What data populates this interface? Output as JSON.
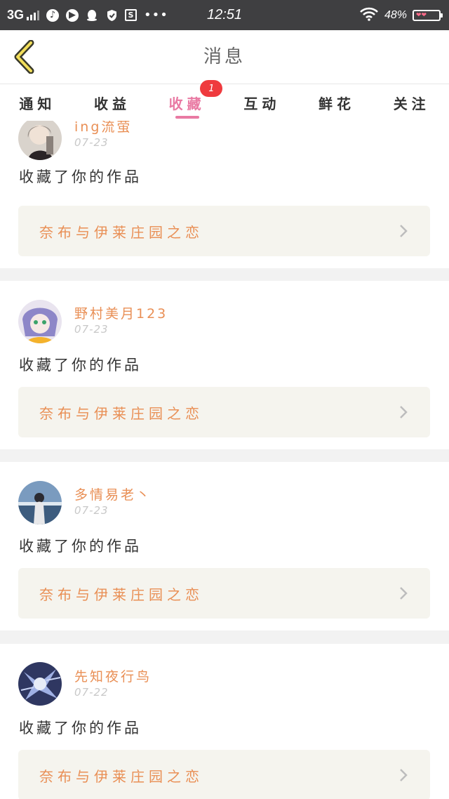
{
  "status_bar": {
    "network": "3G",
    "time": "12:51",
    "battery_percent": "48%",
    "battery_level": 0.48,
    "icons": [
      "signal-icon",
      "music-app-icon",
      "video-app-icon",
      "qq-icon",
      "shield-icon",
      "s-app-icon",
      "more-icon",
      "wifi-icon",
      "battery-icon"
    ]
  },
  "header": {
    "title": "消息",
    "back_icon": "chevron-left-icon"
  },
  "tabs": [
    {
      "label": "通知"
    },
    {
      "label": "收益"
    },
    {
      "label": "收藏",
      "badge": "1",
      "active": true
    },
    {
      "label": "互动"
    },
    {
      "label": "鲜花"
    },
    {
      "label": "关注"
    }
  ],
  "messages": [
    {
      "username": "ing流萤",
      "date": "07-23",
      "action": "收藏了你的作品",
      "work_title": "奈布与伊莱庄园之恋"
    },
    {
      "username": "野村美月123",
      "date": "07-23",
      "action": "收藏了你的作品",
      "work_title": "奈布与伊莱庄园之恋"
    },
    {
      "username": "多情易老丶",
      "date": "07-23",
      "action": "收藏了你的作品",
      "work_title": "奈布与伊莱庄园之恋"
    },
    {
      "username": "先知夜行鸟",
      "date": "07-22",
      "action": "收藏了你的作品",
      "work_title": "奈布与伊莱庄园之恋"
    }
  ],
  "colors": {
    "accent_pink": "#e97aa3",
    "accent_orange": "#e98f55",
    "badge_red": "#ef3a3e",
    "status_bar": "#3f3f41"
  }
}
